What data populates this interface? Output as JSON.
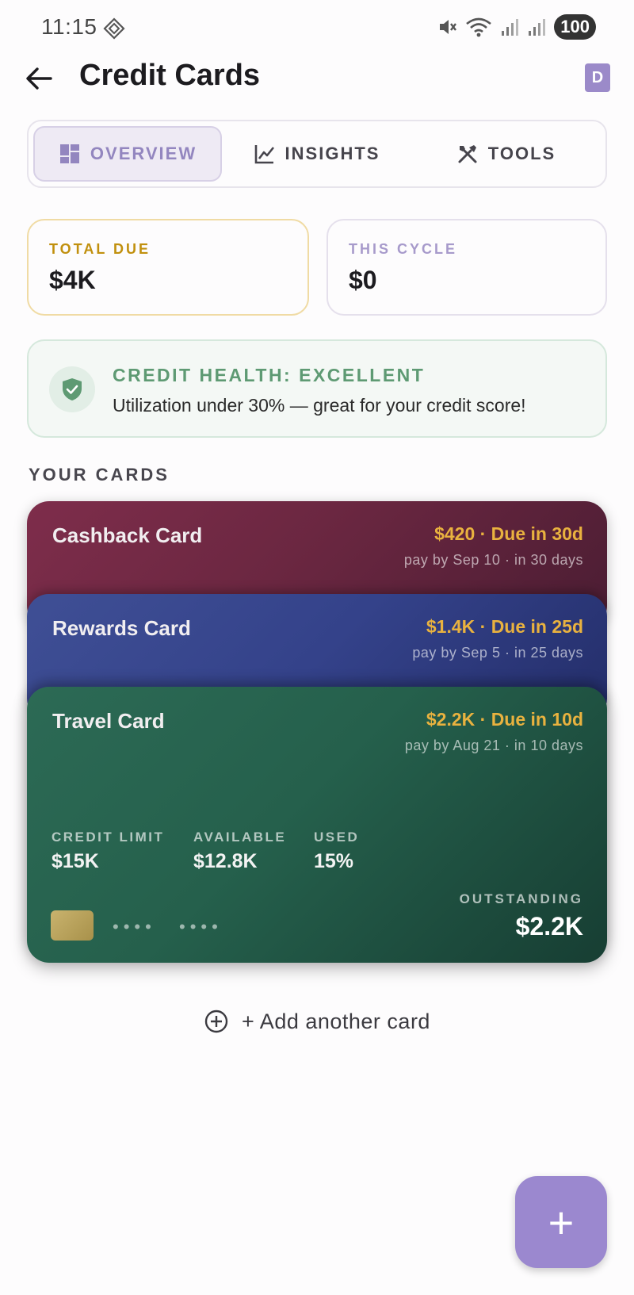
{
  "status_bar": {
    "time": "11:15",
    "battery": "100"
  },
  "app_bar": {
    "title": "Credit Cards",
    "avatar_letter": "D"
  },
  "tabs": [
    {
      "label": "OVERVIEW",
      "icon": "dashboard-icon",
      "active": true
    },
    {
      "label": "INSIGHTS",
      "icon": "chart-icon",
      "active": false
    },
    {
      "label": "TOOLS",
      "icon": "tools-icon",
      "active": false
    }
  ],
  "summary": {
    "total_due": {
      "label": "TOTAL DUE",
      "value": "$4K"
    },
    "this_cycle": {
      "label": "THIS CYCLE",
      "value": "$0"
    }
  },
  "health": {
    "title": "CREDIT HEALTH: EXCELLENT",
    "text": "Utilization under 30% — great for your credit score!"
  },
  "section_title": "YOUR CARDS",
  "cards": [
    {
      "name": "Cashback Card",
      "due": "$420 · Due in 30d",
      "sub": "pay by Sep 10 · in 30 days"
    },
    {
      "name": "Rewards Card",
      "due": "$1.4K · Due in 25d",
      "sub": "pay by Sep 5 · in 25 days"
    },
    {
      "name": "Travel Card",
      "due": "$2.2K · Due in 10d",
      "sub": "pay by Aug 21 · in 10 days",
      "credit_limit_label": "CREDIT LIMIT",
      "credit_limit": "$15K",
      "available_label": "AVAILABLE",
      "available": "$12.8K",
      "used_label": "USED",
      "used": "15%",
      "dots_1": "••••",
      "dots_2": "••••",
      "outstanding_label": "OUTSTANDING",
      "outstanding": "$2.2K"
    }
  ],
  "add_card_label": "+ Add another card",
  "fab_label": "+",
  "colors": {
    "accent": "#9b88cf",
    "due_amber": "#e9b23f",
    "health_green": "#5e9a73",
    "cashback": "#6b2741",
    "rewards": "#34428a",
    "travel": "#25604c"
  }
}
